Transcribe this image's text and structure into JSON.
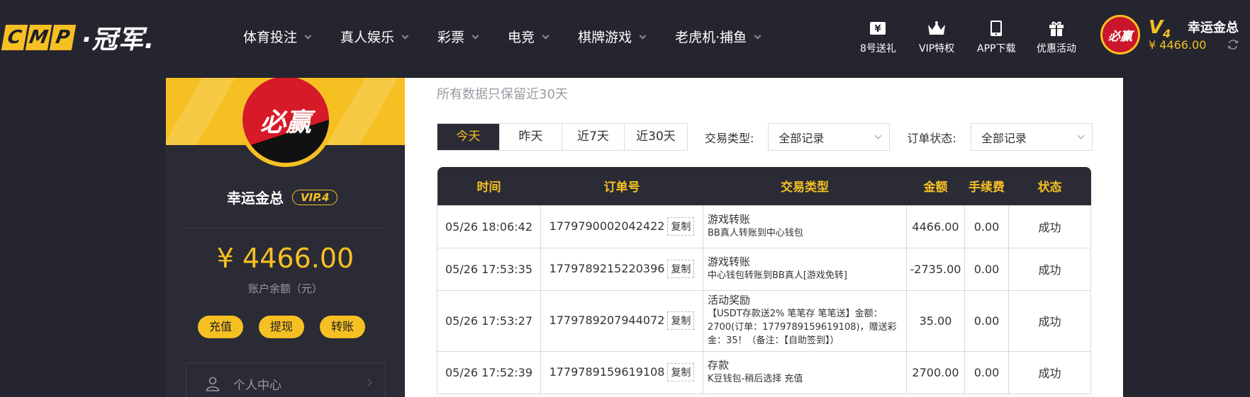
{
  "header": {
    "logo_letters": [
      "C",
      "M",
      "P"
    ],
    "logo_text": "·冠军.",
    "nav": [
      {
        "label": "体育投注"
      },
      {
        "label": "真人娱乐"
      },
      {
        "label": "彩票"
      },
      {
        "label": "电竞"
      },
      {
        "label": "棋牌游戏"
      },
      {
        "label": "老虎机·捕鱼"
      }
    ],
    "quick_links": [
      {
        "label": "8号送礼",
        "icon": "yen-ticket-icon"
      },
      {
        "label": "VIP特权",
        "icon": "crown-icon"
      },
      {
        "label": "APP下载",
        "icon": "phone-icon"
      },
      {
        "label": "优惠活动",
        "icon": "gift-icon"
      }
    ],
    "avatar_text": "必赢",
    "vip_level": "V",
    "vip_level_num": "4",
    "balance": "¥ 4466.00",
    "username": "幸运金总"
  },
  "sidebar": {
    "avatar_text": "必赢",
    "username": "幸运金总",
    "vip_badge": "VIP.4",
    "balance": "¥ 4466.00",
    "balance_label": "账户余额（元）",
    "buttons": [
      {
        "label": "充值"
      },
      {
        "label": "提现"
      },
      {
        "label": "转账"
      }
    ],
    "menu_item": "个人中心"
  },
  "main": {
    "notice": "所有数据只保留近30天",
    "date_tabs": [
      {
        "label": "今天",
        "active": true
      },
      {
        "label": "昨天",
        "active": false
      },
      {
        "label": "近7天",
        "active": false
      },
      {
        "label": "近30天",
        "active": false
      }
    ],
    "type_label": "交易类型:",
    "type_value": "全部记录",
    "status_label": "订单状态:",
    "status_value": "全部记录",
    "table": {
      "headers": [
        "时间",
        "订单号",
        "交易类型",
        "金额",
        "手续费",
        "状态"
      ],
      "copy_label": "复制",
      "rows": [
        {
          "time": "05/26 18:06:42",
          "order": "1779790002042422",
          "type": "游戏转账",
          "detail": "BB真人转账到中心钱包",
          "amount": "4466.00",
          "fee": "0.00",
          "status": "成功"
        },
        {
          "time": "05/26 17:53:35",
          "order": "1779789215220396",
          "type": "游戏转账",
          "detail": "中心钱包转账到BB真人[游戏免转]",
          "amount": "-2735.00",
          "fee": "0.00",
          "status": "成功"
        },
        {
          "time": "05/26 17:53:27",
          "order": "1779789207944072",
          "type": "活动奖励",
          "detail": "【USDT存款送2% 笔笔存 笔笔送】金额：2700(订单：1779789159619108)，赠送彩金：35！（备注：【自助签到】）",
          "amount": "35.00",
          "fee": "0.00",
          "status": "成功"
        },
        {
          "time": "05/26 17:52:39",
          "order": "1779789159619108",
          "type": "存款",
          "detail": "K豆钱包-稍后选择 充值",
          "amount": "2700.00",
          "fee": "0.00",
          "status": "成功"
        }
      ]
    }
  },
  "colors": {
    "accent": "#f6c023",
    "dark_bg": "#25252f",
    "panel_bg": "#2b2b35",
    "success": "#2f8f2f"
  }
}
